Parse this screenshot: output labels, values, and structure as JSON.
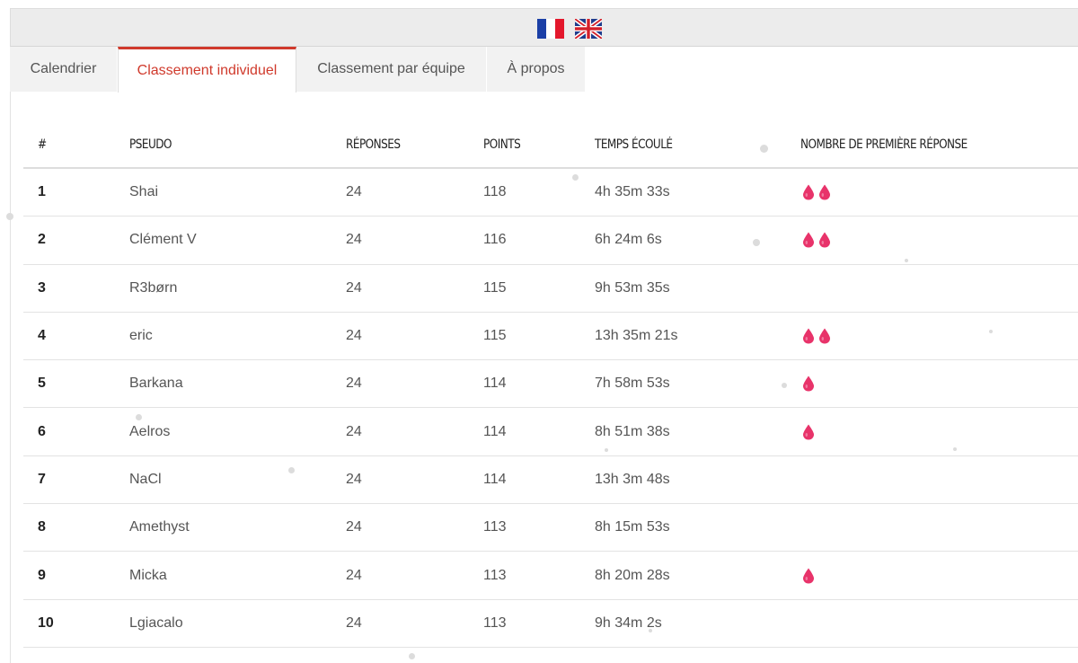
{
  "tabs": [
    {
      "label": "Calendrier",
      "active": false
    },
    {
      "label": "Classement individuel",
      "active": true
    },
    {
      "label": "Classement par équipe",
      "active": false
    },
    {
      "label": "À propos",
      "active": false
    }
  ],
  "languages": [
    {
      "code": "fr",
      "icon": "france-flag-icon"
    },
    {
      "code": "en",
      "icon": "uk-flag-icon"
    }
  ],
  "colors": {
    "accent": "#d03a2c",
    "drop": "#e8336a"
  },
  "table": {
    "headers": {
      "rank": "#",
      "pseudo": "PSEUDO",
      "answers": "RÉPONSES",
      "points": "POINTS",
      "time": "TEMPS ÉCOULÉ",
      "first": "NOMBRE DE PREMIÈRE RÉPONSE"
    },
    "rows": [
      {
        "rank": "1",
        "pseudo": "Shai",
        "answers": "24",
        "points": "118",
        "time": "4h 35m 33s",
        "first_count": 2
      },
      {
        "rank": "2",
        "pseudo": "Clément V",
        "answers": "24",
        "points": "116",
        "time": "6h 24m 6s",
        "first_count": 2
      },
      {
        "rank": "3",
        "pseudo": "R3børn",
        "answers": "24",
        "points": "115",
        "time": "9h 53m 35s",
        "first_count": 0
      },
      {
        "rank": "4",
        "pseudo": "eric",
        "answers": "24",
        "points": "115",
        "time": "13h 35m 21s",
        "first_count": 2
      },
      {
        "rank": "5",
        "pseudo": "Barkana",
        "answers": "24",
        "points": "114",
        "time": "7h 58m 53s",
        "first_count": 1
      },
      {
        "rank": "6",
        "pseudo": "Aelros",
        "answers": "24",
        "points": "114",
        "time": "8h 51m 38s",
        "first_count": 1
      },
      {
        "rank": "7",
        "pseudo": "NaCl",
        "answers": "24",
        "points": "114",
        "time": "13h 3m 48s",
        "first_count": 0
      },
      {
        "rank": "8",
        "pseudo": "Amethyst",
        "answers": "24",
        "points": "113",
        "time": "8h 15m 53s",
        "first_count": 0
      },
      {
        "rank": "9",
        "pseudo": "Micka",
        "answers": "24",
        "points": "113",
        "time": "8h 20m 28s",
        "first_count": 1
      },
      {
        "rank": "10",
        "pseudo": "Lgiacalo",
        "answers": "24",
        "points": "113",
        "time": "9h 34m 2s",
        "first_count": 0
      }
    ]
  }
}
